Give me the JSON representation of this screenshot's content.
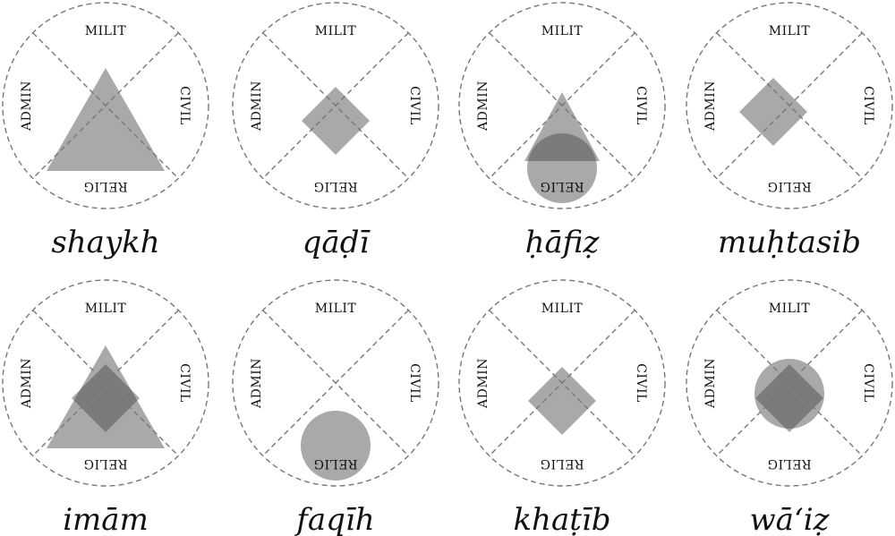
{
  "segments": {
    "top": "MILIT",
    "right": "CIVIL",
    "bottom": "RELIG",
    "left": "ADMIN"
  },
  "colors": {
    "ring": "#777777",
    "shape": "#a9a9ab",
    "overlap": "#7b7b7d"
  },
  "roles": [
    {
      "term": "shaykh",
      "shapes": [
        "triangle"
      ]
    },
    {
      "term": "qāḍī",
      "shapes": [
        "diamond"
      ]
    },
    {
      "term": "ḥāfiẓ",
      "shapes": [
        "small-triangle",
        "circle-bottom"
      ]
    },
    {
      "term": "muḥtasib",
      "shapes": [
        "diamond-left"
      ]
    },
    {
      "term": "imām",
      "shapes": [
        "triangle",
        "diamond"
      ]
    },
    {
      "term": "faqīh",
      "shapes": [
        "circle-bottom"
      ]
    },
    {
      "term": "khaṭīb",
      "shapes": [
        "diamond-lower"
      ]
    },
    {
      "term": "wā‘iẓ",
      "shapes": [
        "circle-center",
        "diamond"
      ]
    }
  ]
}
